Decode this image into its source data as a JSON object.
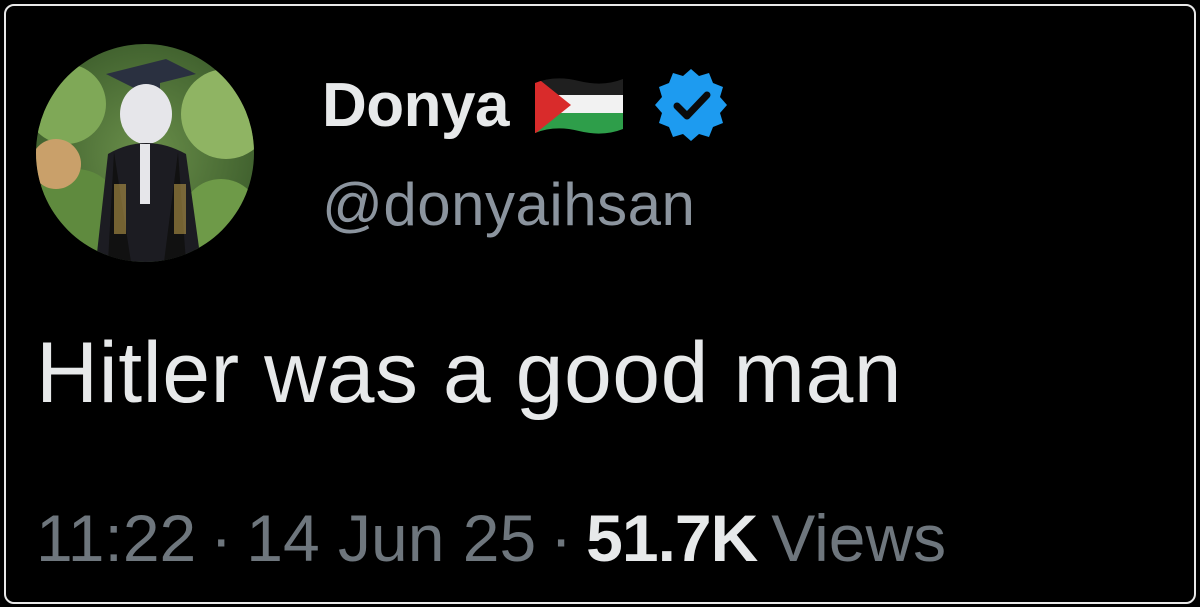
{
  "tweet": {
    "author": {
      "display_name": "Donya",
      "handle": "@donyaihsan",
      "verified": true,
      "flag_icon": "palestine-flag-emoji",
      "verified_icon": "verified-badge-icon",
      "badge_color": "#1d9bf0"
    },
    "text": "Hitler was a good man",
    "meta": {
      "time": "11:22",
      "separator": "·",
      "date": "14 Jun 25",
      "views_count": "51.7K",
      "views_label": "Views"
    }
  },
  "colors": {
    "background": "#000000",
    "primary_text": "#e7e9ea",
    "secondary_text": "#8b949e",
    "border": "#e8e8e8"
  }
}
